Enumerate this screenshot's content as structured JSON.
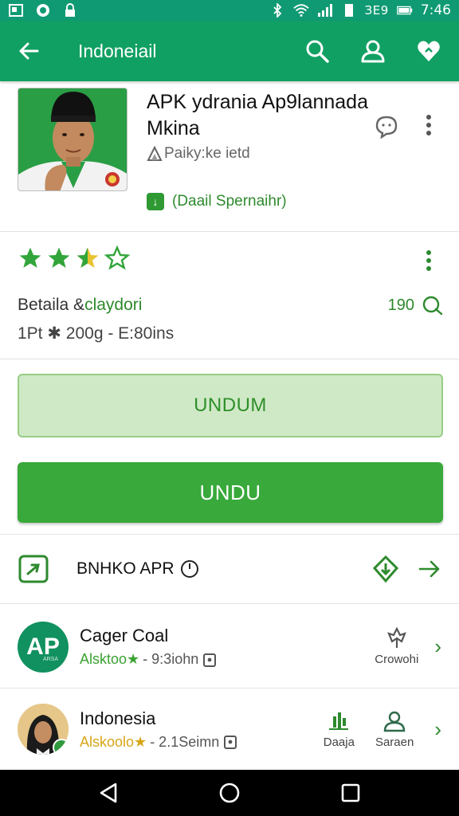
{
  "status_bar": {
    "battery_text": "ЗЕ9",
    "time": "7:46"
  },
  "app_bar": {
    "title": "Indoneiail",
    "icons": [
      "back-arrow-icon",
      "search-icon",
      "account-icon",
      "wishlist-icon"
    ]
  },
  "app": {
    "name": "APK ydrania Ap9lannada Mkina",
    "developer": "Paiky:ke ietd",
    "badge_icon_text": "↓",
    "badge_text": "(Daail Spernaihr)"
  },
  "rating": {
    "stars_filled": 2.5,
    "stars_max": 4,
    "details_label_prefix": "Betaila &",
    "details_label_link": "claydori",
    "reviews_count": "190",
    "meta": "1Pt ✱ 200g - E:80ins"
  },
  "buttons": {
    "secondary": "UNDUM",
    "primary": "UNDU"
  },
  "feature": {
    "label": "BNHKO APR"
  },
  "list": [
    {
      "title": "Cager Coal",
      "rating_text": "Alsktoo★",
      "size": "- 9:3iohn",
      "action_label": "Crowohi",
      "logo_text": "AP",
      "logo_sub": "ARSA"
    },
    {
      "title": "Indonesia",
      "rating_text": "Alskoolo★",
      "size": "- 2.1Seimn",
      "action1_label": "Daaja",
      "action2_label": "Saraen"
    }
  ],
  "colors": {
    "status_bar": "#0f9a73",
    "app_bar": "#11a063",
    "accent_green": "#38a93a",
    "light_green": "#cfe9c6"
  }
}
